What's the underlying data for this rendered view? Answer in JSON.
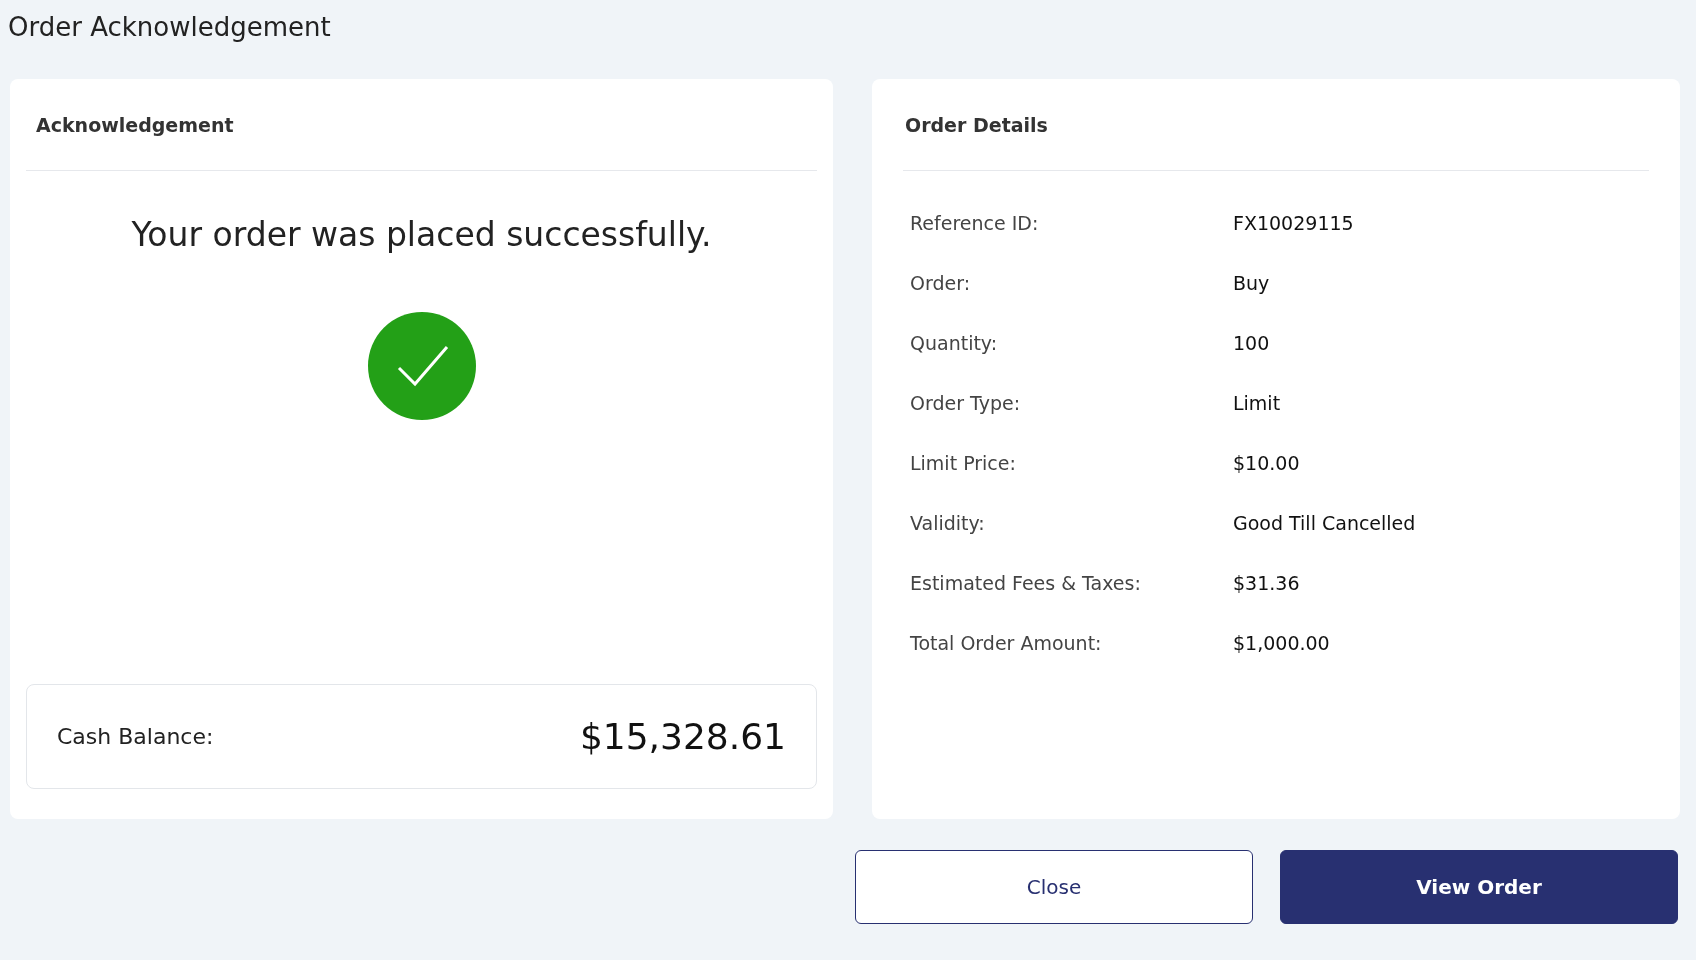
{
  "page_title": "Order Acknowledgement",
  "acknowledgement": {
    "heading": "Acknowledgement",
    "message": "Your order was placed successfully.",
    "success": true,
    "cash_balance": {
      "label": "Cash Balance:",
      "value": "$15,328.61"
    }
  },
  "order_details": {
    "heading": "Order Details",
    "rows": [
      {
        "label": "Reference ID:",
        "value": "FX10029115"
      },
      {
        "label": "Order:",
        "value": "Buy"
      },
      {
        "label": "Quantity:",
        "value": "100"
      },
      {
        "label": "Order Type:",
        "value": "Limit"
      },
      {
        "label": "Limit Price:",
        "value": "$10.00"
      },
      {
        "label": "Validity:",
        "value": "Good Till Cancelled"
      },
      {
        "label": "Estimated Fees & Taxes:",
        "value": "$31.36"
      },
      {
        "label": "Total Order Amount:",
        "value": "$1,000.00"
      }
    ]
  },
  "buttons": [
    {
      "label": "Close",
      "kind": "secondary"
    },
    {
      "label": "View Order",
      "kind": "primary"
    }
  ]
}
